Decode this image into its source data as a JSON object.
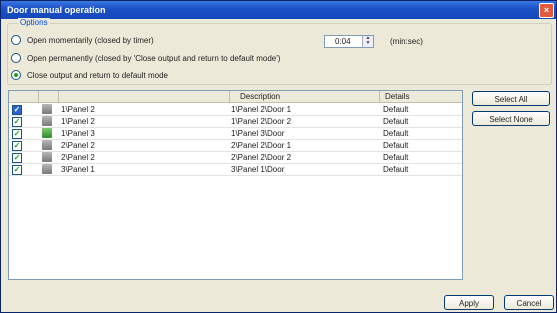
{
  "window": {
    "title": "Door manual operation",
    "close": "×"
  },
  "options": {
    "label": "Options",
    "radios": [
      {
        "label": "Open momentarily (closed by timer)",
        "checked": false
      },
      {
        "label": "Open permanently (closed by 'Close output and return to default mode')",
        "checked": false
      },
      {
        "label": "Close output and return to default mode",
        "checked": true
      }
    ],
    "timer_value": "0:04",
    "timer_unit": "(min:sec)"
  },
  "table": {
    "columns": [
      "Description",
      "Details"
    ],
    "rows": [
      {
        "checked": true,
        "selected": true,
        "icon": "door-icon",
        "panel": "1\\Panel 2",
        "description": "1\\Panel 2\\Door 1",
        "details": "Default"
      },
      {
        "checked": true,
        "selected": false,
        "icon": "door-icon",
        "panel": "1\\Panel 2",
        "description": "1\\Panel 2\\Door 2",
        "details": "Default"
      },
      {
        "checked": true,
        "selected": false,
        "icon": "door-open-icon",
        "panel": "1\\Panel 3",
        "description": "1\\Panel 3\\Door",
        "details": "Default"
      },
      {
        "checked": true,
        "selected": false,
        "icon": "door-icon",
        "panel": "2\\Panel 2",
        "description": "2\\Panel 2\\Door 1",
        "details": "Default"
      },
      {
        "checked": true,
        "selected": false,
        "icon": "door-icon",
        "panel": "2\\Panel 2",
        "description": "2\\Panel 2\\Door 2",
        "details": "Default"
      },
      {
        "checked": true,
        "selected": false,
        "icon": "door-icon",
        "panel": "3\\Panel 1",
        "description": "3\\Panel 1\\Door",
        "details": "Default"
      }
    ]
  },
  "buttons": {
    "select_all": "Select All",
    "select_none": "Select None",
    "apply": "Apply",
    "cancel": "Cancel"
  }
}
